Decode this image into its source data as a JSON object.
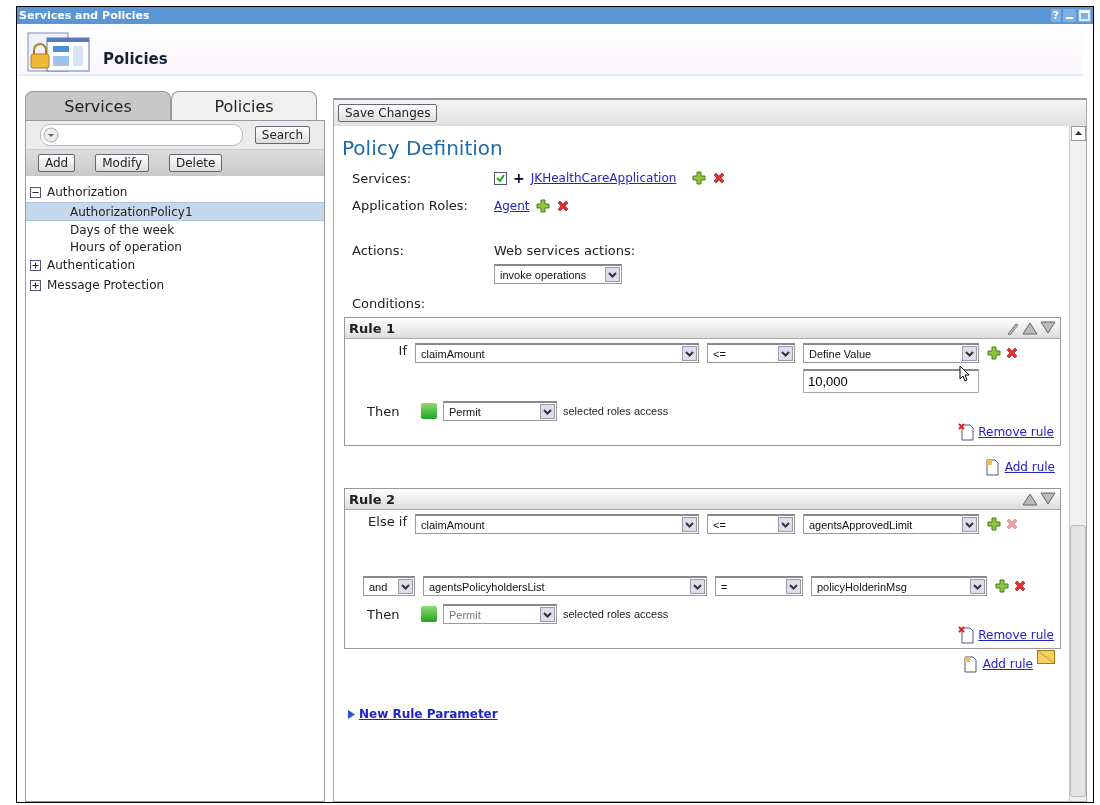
{
  "window": {
    "title": "Services and Policies",
    "controls": [
      "?"
    ]
  },
  "header": {
    "title": "Policies"
  },
  "left_panel": {
    "tabs": [
      {
        "label": "Services",
        "selected": false
      },
      {
        "label": "Policies",
        "selected": true
      }
    ],
    "search": {
      "button": "Search"
    },
    "buttons": [
      "Add",
      "Modify",
      "Delete"
    ],
    "tree": [
      {
        "label": "Authorization",
        "expanded": true,
        "selected": false,
        "children": [
          {
            "label": "AuthorizationPolicy1",
            "selected": true
          },
          {
            "label": "Days of the week",
            "selected": false
          },
          {
            "label": "Hours of operation",
            "selected": false
          }
        ]
      },
      {
        "label": "Authentication",
        "expanded": false,
        "selected": false
      },
      {
        "label": "Message Protection",
        "expanded": false,
        "selected": false
      }
    ]
  },
  "toolbar": {
    "save": "Save Changes"
  },
  "policy": {
    "title": "Policy Definition",
    "services": {
      "label": "Services:",
      "checked": true,
      "plus": "+",
      "link": "JKHealthCareApplication"
    },
    "roles": {
      "label": "Application Roles:",
      "link": "Agent"
    },
    "actions": {
      "label": "Actions:",
      "sublabel": "Web services actions:",
      "value": "invoke operations"
    },
    "conditions_label": "Conditions:",
    "rules": [
      {
        "title": "Rule 1",
        "edit_icon": true,
        "conditions": [
          {
            "kind": "label",
            "connector": "If",
            "field": "claimAmount",
            "operator": "<=",
            "value": "Define Value",
            "input": "10,000",
            "remove_disabled": false
          }
        ],
        "then": {
          "label": "Then",
          "value": "Permit",
          "disabled": false,
          "text": "selected roles access"
        },
        "remove": "Remove rule",
        "add": "Add rule",
        "note_icon": false
      },
      {
        "title": "Rule 2",
        "edit_icon": false,
        "conditions": [
          {
            "kind": "label",
            "connector": "Else if",
            "field": "claimAmount",
            "operator": "<=",
            "value": "agentsApprovedLimit",
            "remove_disabled": true
          },
          {
            "kind": "select",
            "connector": "and",
            "field": "agentsPolicyholdersList",
            "operator": "=",
            "value": "policyHolderinMsg",
            "remove_disabled": false
          }
        ],
        "then": {
          "label": "Then",
          "value": "Permit",
          "disabled": true,
          "text": "selected roles access"
        },
        "remove": "Remove rule",
        "add": "Add rule",
        "note_icon": true
      }
    ],
    "new_param": "New Rule Parameter"
  }
}
